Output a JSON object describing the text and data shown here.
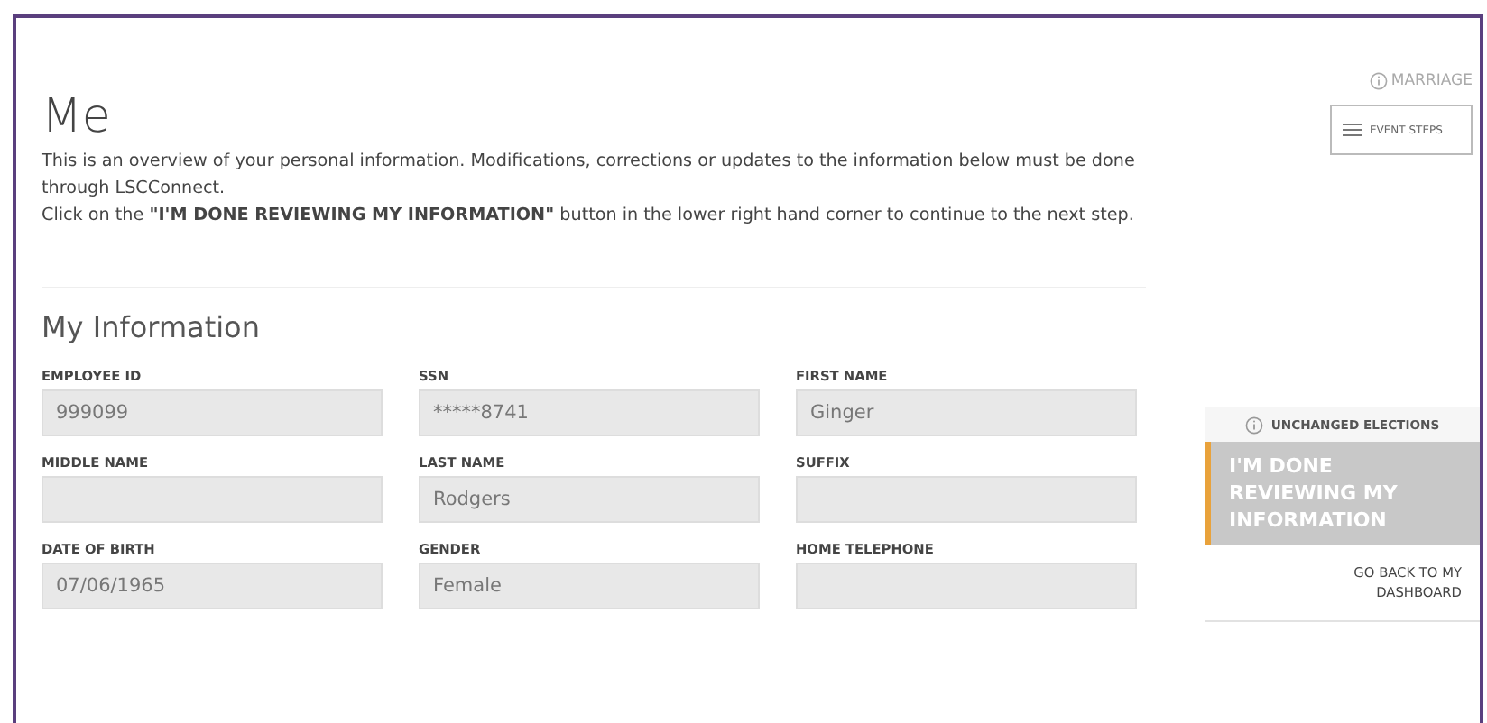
{
  "page": {
    "title": "Me",
    "intro": [
      "This is an overview of your personal information. Modifications, corrections or updates to the information below must be done through LSCConnect.",
      "Click on the **\"I'M DONE REVIEWING MY INFORMATION\"** button in the lower right hand corner to continue to the next step."
    ]
  },
  "section": {
    "title": "My Information",
    "fields": [
      {
        "label": "EMPLOYEE ID",
        "value": "999099"
      },
      {
        "label": "SSN",
        "value": "*****8741"
      },
      {
        "label": "FIRST NAME",
        "value": "Ginger"
      },
      {
        "label": "MIDDLE NAME"
      },
      {
        "label": "LAST NAME",
        "value": "Rodgers"
      },
      {
        "label": "SUFFIX"
      },
      {
        "label": "DATE OF BIRTH",
        "value": "07/06/1965"
      },
      {
        "label": "GENDER",
        "value": "Female"
      },
      {
        "label": "HOME TELEPHONE"
      }
    ]
  },
  "sidebar": {
    "event": "MARRIAGE",
    "event_steps_button": "EVENT STEPS",
    "notice": "UNCHANGED ELECTIONS",
    "done_button": "I'M DONE REVIEWING MY INFORMATION",
    "back_link": "GO BACK TO MY DASHBOARD"
  }
}
